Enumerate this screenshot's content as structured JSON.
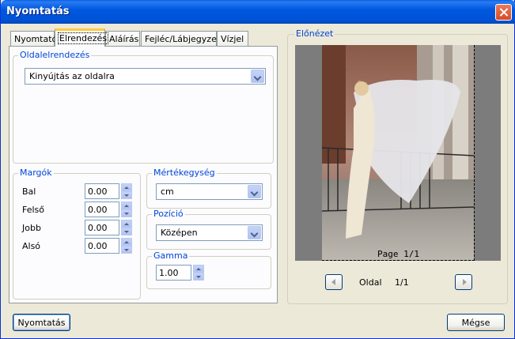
{
  "window": {
    "title": "Nyomtatás"
  },
  "tabs": [
    {
      "label": "Nyomtató"
    },
    {
      "label": "Elrendezés",
      "active": true
    },
    {
      "label": "Aláírás"
    },
    {
      "label": "Fejléc/Lábjegyzet"
    },
    {
      "label": "Vízjel"
    }
  ],
  "layout_group": {
    "label": "Oldalelrendezés",
    "selected": "Kinyújtás az oldalra"
  },
  "margins": {
    "label": "Margók",
    "fields": [
      {
        "label": "Bal",
        "value": "0.00"
      },
      {
        "label": "Felső",
        "value": "0.00"
      },
      {
        "label": "Jobb",
        "value": "0.00"
      },
      {
        "label": "Alsó",
        "value": "0.00"
      }
    ]
  },
  "unit": {
    "label": "Mértékegység",
    "selected": "cm"
  },
  "position": {
    "label": "Pozíció",
    "selected": "Középen"
  },
  "gamma": {
    "label": "Gamma",
    "value": "1.00"
  },
  "preview": {
    "label": "Előnézet",
    "page_overlay": "Page 1/1",
    "page_label": "Oldal",
    "page_count": "1/1"
  },
  "buttons": {
    "print": "Nyomtatás",
    "cancel": "Mégse"
  }
}
